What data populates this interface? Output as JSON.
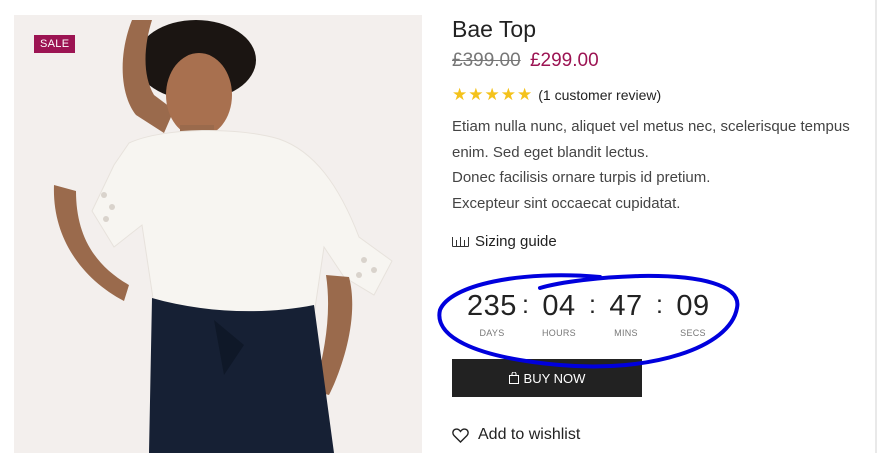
{
  "product": {
    "badge": "SALE",
    "title": "Bae Top",
    "price_old": "£399.00",
    "price_new": "£299.00",
    "rating": {
      "stars": 5,
      "max": 5,
      "review_text": "(1 customer review)"
    },
    "description": [
      "Etiam nulla nunc, aliquet vel metus nec, scelerisque tempus enim. Sed eget blandit lectus.",
      "Donec facilisis ornare turpis id pretium.",
      "Excepteur sint occaecat cupidatat."
    ],
    "sizing_label": "Sizing guide",
    "countdown": {
      "days": "235",
      "days_label": "DAYS",
      "hours": "04",
      "hours_label": "HOURS",
      "mins": "47",
      "mins_label": "MINS",
      "secs": "09",
      "secs_label": "SECS",
      "separator": ":"
    },
    "buy_label": "BUY NOW",
    "wishlist_label": "Add to wishlist"
  },
  "colors": {
    "sale": "#9c1453",
    "price_new": "#9c1453",
    "star": "#f4c21b",
    "button": "#222222",
    "annotation": "#0000dd"
  },
  "icons": {
    "sizing": "ruler-icon",
    "buy": "shopping-bag-icon",
    "wishlist": "heart-icon",
    "star": "star-icon"
  }
}
